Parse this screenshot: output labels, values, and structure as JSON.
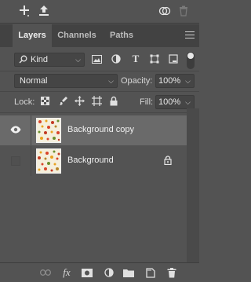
{
  "toolbar": {
    "icons": [
      "add-icon",
      "export-icon",
      "link-icon",
      "trash-icon"
    ]
  },
  "tabs": [
    {
      "label": "Layers",
      "active": true
    },
    {
      "label": "Channels",
      "active": false
    },
    {
      "label": "Paths",
      "active": false
    }
  ],
  "filter": {
    "kind_label": "Kind",
    "icons": [
      "image-filter-icon",
      "adjustment-filter-icon",
      "type-filter-icon",
      "shape-filter-icon",
      "smart-object-filter-icon",
      "filter-toggle-icon"
    ]
  },
  "blend": {
    "mode": "Normal",
    "opacity_label": "Opacity:",
    "opacity_value": "100%"
  },
  "lock": {
    "label": "Lock:",
    "icons": [
      "lock-transparent-icon",
      "lock-paint-icon",
      "lock-position-icon",
      "lock-artboard-icon",
      "lock-all-icon"
    ],
    "fill_label": "Fill:",
    "fill_value": "100%"
  },
  "layers": [
    {
      "name": "Background copy",
      "visible": true,
      "selected": true,
      "locked": false
    },
    {
      "name": "Background",
      "visible": false,
      "selected": false,
      "locked": true
    }
  ],
  "bottom_icons": [
    "link-layers-icon",
    "fx-icon",
    "mask-icon",
    "adjustment-icon",
    "group-icon",
    "new-layer-icon",
    "delete-layer-icon"
  ],
  "bottom": {
    "fx_label": "fx"
  },
  "colors": {
    "panel": "#535353",
    "tabbar": "#424242",
    "selected_row": "#6a6a6a"
  }
}
